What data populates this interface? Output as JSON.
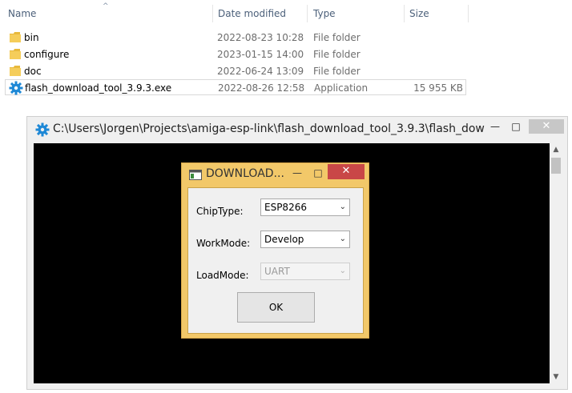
{
  "explorer": {
    "columns": {
      "name": "Name",
      "date": "Date modified",
      "type": "Type",
      "size": "Size"
    },
    "rows": [
      {
        "name": "bin",
        "date": "2022-08-23 10:28",
        "type": "File folder",
        "size": ""
      },
      {
        "name": "configure",
        "date": "2023-01-15 14:00",
        "type": "File folder",
        "size": ""
      },
      {
        "name": "doc",
        "date": "2022-06-24 13:09",
        "type": "File folder",
        "size": ""
      },
      {
        "name": "flash_download_tool_3.9.3.exe",
        "date": "2022-08-26 12:58",
        "type": "Application",
        "size": "15 955 KB"
      }
    ]
  },
  "console": {
    "title": "C:\\Users\\Jorgen\\Projects\\amiga-esp-link\\flash_download_tool_3.9.3\\flash_down..."
  },
  "dialog": {
    "title": "DOWNLOAD...",
    "chip_label": "ChipType:",
    "chip_value": "ESP8266",
    "work_label": "WorkMode:",
    "work_value": "Develop",
    "load_label": "LoadMode:",
    "load_value": "UART",
    "ok_label": "OK"
  },
  "colors": {
    "dialog_frame": "#f2c869",
    "close_button": "#c94747",
    "folder": "#e8b93c",
    "app_gear": "#1e88d6"
  }
}
